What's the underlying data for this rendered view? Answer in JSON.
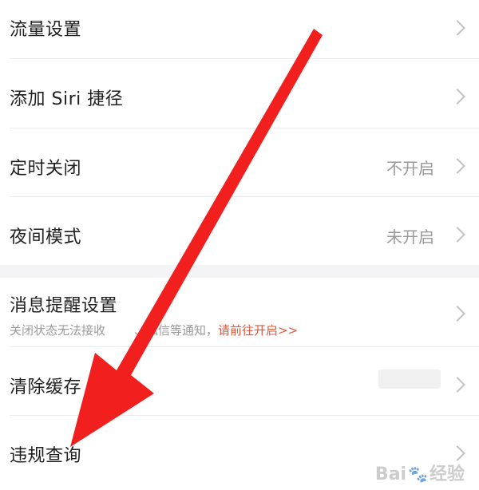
{
  "settings": {
    "items": [
      {
        "label": "流量设置",
        "value": ""
      },
      {
        "label": "添加 Siri 捷径",
        "value": ""
      },
      {
        "label": "定时关闭",
        "value": "不开启"
      },
      {
        "label": "夜间模式",
        "value": "未开启"
      },
      {
        "label": "消息提醒设置",
        "value": ""
      },
      {
        "label": "清除缓存",
        "value": ""
      },
      {
        "label": "违规查询",
        "value": ""
      }
    ],
    "notification_hint": "关闭状态无法接收",
    "notification_hint_mid": "、私信等通知，",
    "notification_link": "请前往开启>>"
  },
  "overlay": {
    "arrow_color": "#f21f1f",
    "watermark_text": "Bai",
    "watermark_text2": "经验",
    "watermark_icon": "paw-icon"
  },
  "colors": {
    "link": "#e0573a",
    "label": "#1f1f1f",
    "secondary": "#9a9a9a",
    "divider": "#ececee",
    "section_gap": "#f4f4f6"
  }
}
